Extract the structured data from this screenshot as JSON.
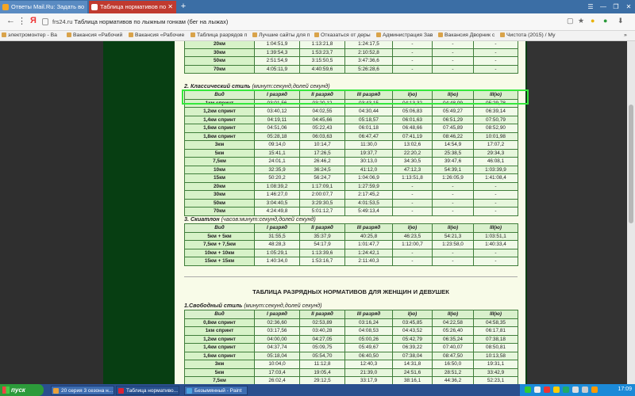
{
  "browser": {
    "tabs": [
      {
        "label": "Ответы Mail.Ru: Задать во"
      },
      {
        "label": "Таблица нормативов по"
      }
    ],
    "new_tab": "+",
    "window_controls": [
      "☰",
      "—",
      "❐",
      "✕"
    ],
    "url_host": "frs24.ru",
    "url_title": "Таблица нормативов по лыжным гонкам (бег на лыжах)",
    "bookmarks": [
      "электромонтер - Ва",
      "Вакансия «Рабочий",
      "Вакансия «Рабочие",
      "Таблица разрядов п",
      "Лучшие сайты для п",
      "Отказаться от деры",
      "Администрация Зав",
      "Вакансия Дворник с",
      "Чистота (2015) / Му"
    ],
    "bookmarks_more": "»"
  },
  "page": {
    "top_table": {
      "rows": [
        [
          "20км",
          "1:04:51,9",
          "1:13:21,8",
          "1:24:17,5",
          "-",
          "-",
          "-"
        ],
        [
          "30км",
          "1:39:54,3",
          "1:53:23,7",
          "2:10:52,8",
          "-",
          "-",
          "-"
        ],
        [
          "50км",
          "2:51:54,9",
          "3:15:50,5",
          "3:47:36,6",
          "-",
          "-",
          "-"
        ],
        [
          "70км",
          "4:05:11,9",
          "4:40:59,6",
          "5:26:28,6",
          "-",
          "-",
          "-"
        ]
      ]
    },
    "section2": {
      "title": "2. Классический стиль",
      "subtitle": "(минут:секунд,долей секунд)",
      "headers": [
        "Вид",
        "I разряд",
        "II разряд",
        "III разряд",
        "I(ю)",
        "II(ю)",
        "III(ю)"
      ],
      "rows": [
        [
          "1км спринт",
          "03:01,56",
          "03:20,12",
          "03:43,15",
          "04:13,32",
          "04:48,09",
          "05:29,78"
        ],
        [
          "1,2км спринт",
          "03:40,12",
          "04:02,55",
          "04:30,44",
          "05:06,83",
          "05:49,27",
          "06:39,14"
        ],
        [
          "1,4км спринт",
          "04:19,11",
          "04:45,66",
          "05:18,57",
          "06:01,63",
          "06:51,29",
          "07:50,79"
        ],
        [
          "1,6км спринт",
          "04:51,06",
          "05:22,43",
          "06:01,18",
          "06:48,66",
          "07:45,89",
          "08:52,90"
        ],
        [
          "1,8км спринт",
          "05:28,18",
          "06:03,63",
          "06:47,47",
          "07:41,19",
          "08:46,22",
          "10:01,98"
        ],
        [
          "3км",
          "09:14,0",
          "10:14,7",
          "11:30,0",
          "13:02,6",
          "14:54,9",
          "17:07,2"
        ],
        [
          "5км",
          "15:41,1",
          "17:26,5",
          "19:37,7",
          "22:20,2",
          "25:38,5",
          "29:34,3"
        ],
        [
          "7,5км",
          "24:01,1",
          "26:46,2",
          "30:13,0",
          "34:30,5",
          "39:47,6",
          "46:08,1"
        ],
        [
          "10км",
          "32:35,9",
          "36:24,5",
          "41:12,0",
          "47:12,3",
          "54:39,1",
          "1:03:39,9"
        ],
        [
          "15км",
          "50:20,2",
          "56:24,7",
          "1:04:06,9",
          "1:13:51,8",
          "1:26:05,9",
          "1:41:08,4"
        ],
        [
          "20км",
          "1:08:39,2",
          "1:17:09,1",
          "1:27:59,9",
          "-",
          "-",
          "-"
        ],
        [
          "30км",
          "1:46:27,0",
          "2:00:07,7",
          "2:17:45,2",
          "-",
          "-",
          "-"
        ],
        [
          "50км",
          "3:04:40,5",
          "3:29:30,5",
          "4:01:53,5",
          "-",
          "-",
          "-"
        ],
        [
          "70км",
          "4:24:49,8",
          "5:01:12,7",
          "5:49:13,4",
          "-",
          "-",
          "-"
        ]
      ]
    },
    "section3": {
      "title": "3. Скиатлон",
      "subtitle": "(часов:минут:секунд,долей секунд)",
      "headers": [
        "Вид",
        "I разряд",
        "II разряд",
        "III разряд",
        "I(ю)",
        "II(ю)",
        "III(ю)"
      ],
      "rows": [
        [
          "5км + 5км",
          "31:55,5",
          "35:37,9",
          "40:25,8",
          "46:23,5",
          "54:21,3",
          "1:03:51,1"
        ],
        [
          "7,5км + 7,5км",
          "48:28,3",
          "54:17,9",
          "1:01:47,7",
          "1:12:00,7",
          "1:23:58,0",
          "1:40:33,4"
        ],
        [
          "10км + 10км",
          "1:05:29,1",
          "1:13:39,6",
          "1:24:42,1",
          "-",
          "-",
          "-"
        ],
        [
          "15км + 15км",
          "1:40:34,0",
          "1:53:16,7",
          "2:11:40,3",
          "-",
          "-",
          "-"
        ]
      ]
    },
    "women_title": "ТАБЛИЦА РАЗРЯДНЫХ НОРМАТИВОВ ДЛЯ ЖЕНЩИН И ДЕВУШЕК",
    "section_w1": {
      "title": "1.Свободный стиль",
      "subtitle": "(минут:секунд,долей секунд)",
      "headers": [
        "Вид",
        "I разряд",
        "II разряд",
        "III разряд",
        "I(ю)",
        "II(ю)",
        "III(ю)"
      ],
      "rows": [
        [
          "0,8км спринт",
          "02:36,60",
          "02:53,89",
          "03:16,24",
          "03:45,85",
          "04:22,58",
          "04:58,35"
        ],
        [
          "1км спринт",
          "03:17,56",
          "03:40,28",
          "04:08,53",
          "04:43,52",
          "05:26,40",
          "06:17,81"
        ],
        [
          "1,2км спринт",
          "04:00,00",
          "04:27,05",
          "05:00,26",
          "05:42,79",
          "06:35,24",
          "07:38,18"
        ],
        [
          "1,4км спринт",
          "04:37,74",
          "05:09,75",
          "05:49,67",
          "06:39,22",
          "07:40,07",
          "08:50,81"
        ],
        [
          "1,6км спринт",
          "05:18,04",
          "05:54,70",
          "06:40,50",
          "07:38,04",
          "08:47,50",
          "10:13,58"
        ],
        [
          "3км",
          "10:04,0",
          "11:12,8",
          "12:40,3",
          "14:31,8",
          "16:50,0",
          "19:31,1"
        ],
        [
          "5км",
          "17:03,4",
          "19:05,4",
          "21:39,0",
          "24:51,6",
          "28:51,2",
          "33:42,9"
        ],
        [
          "7,5км",
          "26:02,4",
          "29:12,5",
          "33:17,9",
          "38:16,1",
          "44:36,2",
          "52:23,1"
        ]
      ]
    }
  },
  "taskbar": {
    "start_label": "пуск",
    "tasks": [
      "20 серия 3 сезона н...",
      "Таблица нормативо...",
      "Безымянный - Paint"
    ],
    "clock": "17:09"
  },
  "colors": {
    "tab_active": "#c03a2f",
    "page_dark_bg": "#073e12",
    "content_bg": "#f8fbe8",
    "table_border": "#3f7d3a",
    "highlight": "#35e83c",
    "taskbar": "#2a4f8e",
    "start_button": "#2c9b3a"
  }
}
